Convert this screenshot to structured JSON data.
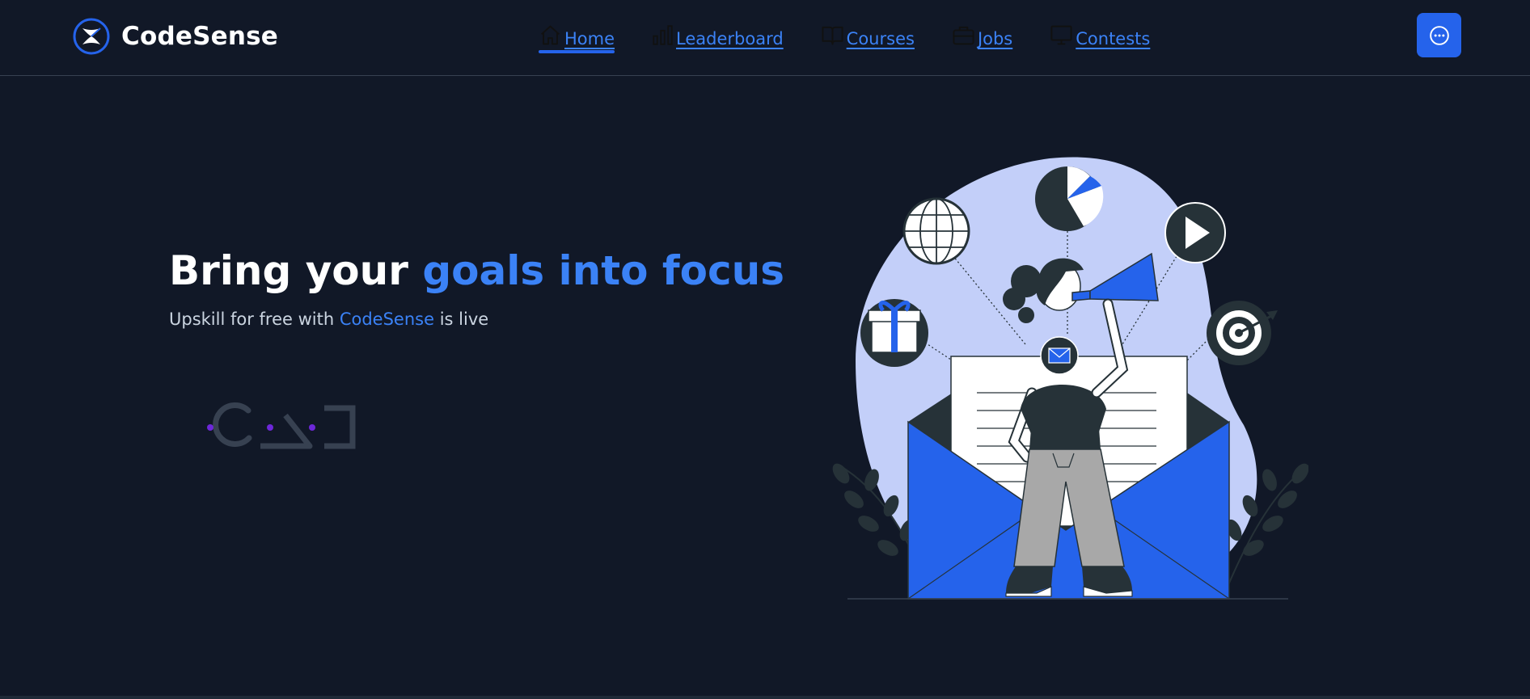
{
  "app": {
    "brand_name": "CodeSense",
    "logo_icon": "codesense-logo-icon"
  },
  "nav": {
    "items": [
      {
        "label": "Home",
        "icon": "home-icon",
        "active": true
      },
      {
        "label": "Leaderboard",
        "icon": "bar-chart-icon",
        "active": false
      },
      {
        "label": "Courses",
        "icon": "open-book-icon",
        "active": false
      },
      {
        "label": "Jobs",
        "icon": "briefcase-icon",
        "active": false
      },
      {
        "label": "Contests",
        "icon": "monitor-icon",
        "active": false
      }
    ],
    "menu_button_icon": "more-dots-icon"
  },
  "hero": {
    "title_plain": "Bring your ",
    "title_accent": "goals into focus",
    "subtitle_before": "Upskill for free with ",
    "subtitle_accent": "CodeSense",
    "subtitle_after": " is live"
  },
  "colors": {
    "background": "#111827",
    "accent": "#3b82f6",
    "button": "#2563eb",
    "illustration_blob": "#c3cff9",
    "illustration_blue": "#2563eb",
    "illustration_dark": "#263238"
  }
}
